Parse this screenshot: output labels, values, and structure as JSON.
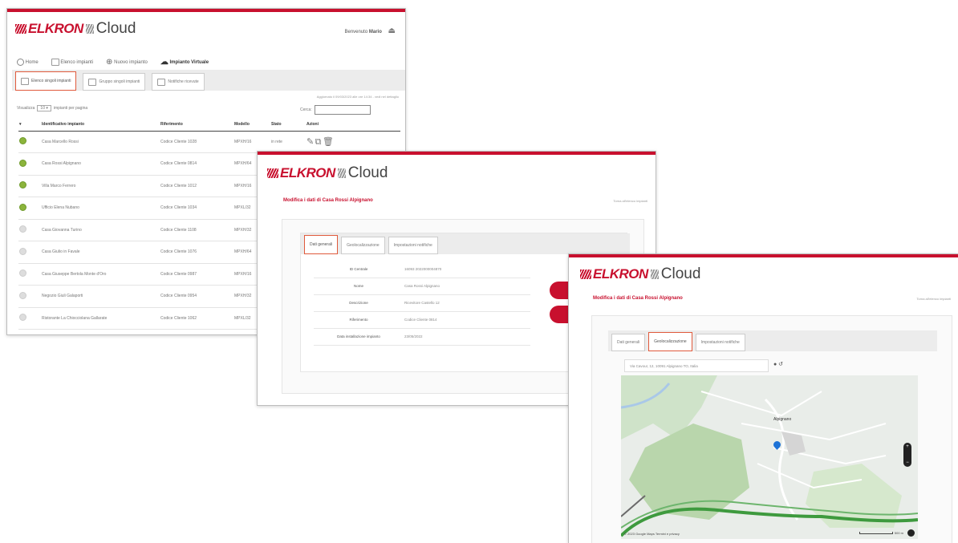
{
  "w1": {
    "logo_brand": "ELKRON",
    "logo_cloud": "Cloud",
    "welcome_prefix": "Benvenuto",
    "welcome_user": "Mario",
    "nav": [
      "Home",
      "Elenco impianti",
      "Nuovo impianto",
      "Impianto Virtuale"
    ],
    "tabs": [
      "Elenco singoli impianti",
      "Gruppo singoli impianti",
      "Notifiche ricevute"
    ],
    "info": "Aggiornato il 09/03/2023 alle ore 14:34 - vedi nel dettaglio",
    "show_label": "Visualizza",
    "show_value": "10",
    "show_suffix": "impianti per pagina",
    "search_label": "Cerca:",
    "columns": [
      "Identificativo impianto",
      "Riferimento",
      "Modello",
      "Stato",
      "Azioni"
    ],
    "rows": [
      {
        "name": "Casa Marcello Rossi",
        "ref": "Codice Cliente 1028",
        "model": "MPXH/16",
        "status": "in rete",
        "st": "green"
      },
      {
        "name": "Casa Rossi Alpignano",
        "ref": "Codice Cliente 0814",
        "model": "MPXH/64",
        "status": "",
        "st": "green"
      },
      {
        "name": "Villa Marco Ferrero",
        "ref": "Codice Cliente 1012",
        "model": "MPXH/16",
        "status": "",
        "st": "green"
      },
      {
        "name": "Ufficio Elena Nubano",
        "ref": "Codice Cliente 1034",
        "model": "MPXL/32",
        "status": "",
        "st": "green"
      },
      {
        "name": "Casa Giovanna Turino",
        "ref": "Codice Cliente 1108",
        "model": "MPXH/32",
        "status": "",
        "st": "gray"
      },
      {
        "name": "Casa Giulio in Favale",
        "ref": "Codice Cliente 1076",
        "model": "MPXH/64",
        "status": "",
        "st": "gray"
      },
      {
        "name": "Casa Giuseppe Bertola Monte d'Oro",
        "ref": "Codice Cliente 0987",
        "model": "MPXH/16",
        "status": "",
        "st": "gray"
      },
      {
        "name": "Negozio Giuli Galaporti",
        "ref": "Codice Cliente 0954",
        "model": "MPXH/32",
        "status": "",
        "st": "gray"
      },
      {
        "name": "Ristorante La Chiocciolana Gallarate",
        "ref": "Codice Cliente 1062",
        "model": "MPXL/32",
        "status": "",
        "st": "gray"
      }
    ]
  },
  "w2": {
    "logo_brand": "ELKRON",
    "logo_cloud": "Cloud",
    "title": "Modifica i dati di Casa Rossi Alpignano",
    "right_link": "Torna all'elenco impianti",
    "tabs": [
      "Dati generali",
      "Geolocalizzazione",
      "Impostazioni notifiche"
    ],
    "fields": [
      {
        "label": "ID Centrale",
        "value": "16093 2022000004870"
      },
      {
        "label": "Nome",
        "value": "Casa Rossi Alpignano"
      },
      {
        "label": "Descrizione",
        "value": "Ricevitore Castello 12"
      },
      {
        "label": "Riferimento",
        "value": "Codice Cliente 0814"
      },
      {
        "label": "Data installazione impianto",
        "value": "23/05/2022"
      }
    ]
  },
  "w3": {
    "logo_brand": "ELKRON",
    "logo_cloud": "Cloud",
    "title": "Modifica i dati di Casa Rossi Alpignano",
    "right_link": "Torna all'elenco impianti",
    "tabs": [
      "Dati generali",
      "Geolocalizzazione",
      "Impostazioni notifiche"
    ],
    "address": "Via Cavour, 12, 10091 Alpignano TO, Italia",
    "town_label": "Alpignano",
    "attribution": "© 2023 Google Maps Termini e privacy",
    "scale": "500 m"
  },
  "colors": {
    "accent": "#c8102e",
    "tab_active": "#e05a3c",
    "status_ok": "#8cb43c"
  }
}
